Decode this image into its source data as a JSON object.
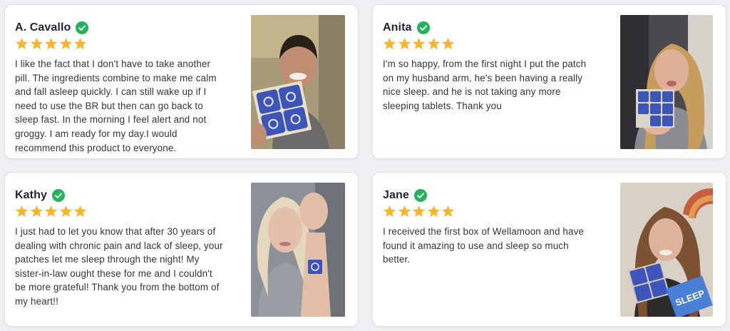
{
  "colors": {
    "verified": "#22b35c",
    "star": "#f7b52c",
    "text": "#2f3440",
    "name": "#1d2433",
    "patch": "#3d55b8"
  },
  "reviews": [
    {
      "name": "A. Cavallo",
      "verified_icon": "verified-check-icon",
      "rating": 5,
      "text_lines": [
        "I like the fact that I don't have to take another",
        "pill. The ingredients combine to make me calm",
        "and fall asleep quickly. I can still wake up if I",
        "need to use the BR but then can go back to",
        "sleep fast. In the morning I feel alert and not",
        "groggy. I am ready for my day.I would",
        "recommend this product to everyone."
      ]
    },
    {
      "name": "Anita",
      "verified_icon": "verified-check-icon",
      "rating": 5,
      "text_lines": [
        "I'm so happy, from the first night I put the patch",
        "on my husband arm, he's been having a really",
        "nice sleep. and he is not taking any more",
        "sleeping tablets. Thank you"
      ]
    },
    {
      "name": "Kathy",
      "verified_icon": "verified-check-icon",
      "rating": 5,
      "text_lines": [
        "I just had to let you know that after 30 years of",
        "dealing with chronic pain and lack of sleep, your",
        "patches let me sleep through the night! My",
        "sister-in-law ought these for me and I couldn't",
        "be more grateful! Thank you from the bottom of",
        "my heart!!"
      ]
    },
    {
      "name": "Jane",
      "verified_icon": "verified-check-icon",
      "rating": 5,
      "text_lines": [
        "I received the first box of Wellamoon and have",
        "found it amazing to use and sleep so much",
        "better."
      ]
    }
  ],
  "photos": {
    "jane_box_label": "SLEEP"
  }
}
